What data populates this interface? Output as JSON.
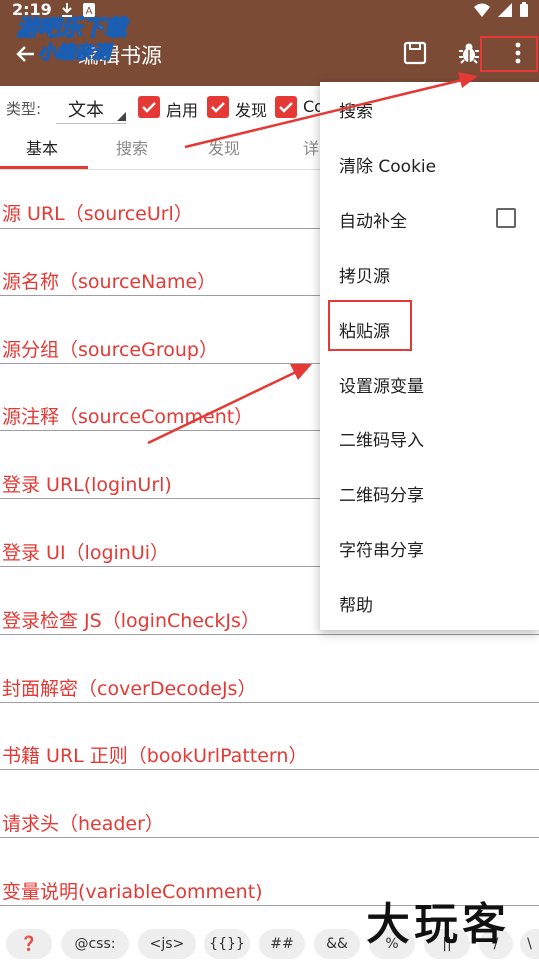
{
  "status_bar": {
    "time": "2:19"
  },
  "watermark": {
    "line1": "游吧乐下载",
    "line2": "小编亲测"
  },
  "app_bar": {
    "title": "编辑书源",
    "back_icon": "arrow-left-icon",
    "actions": [
      "save-icon",
      "bug-icon",
      "more-vert-icon"
    ]
  },
  "type_row": {
    "label": "类型:",
    "selected": "文本",
    "checkboxes": [
      {
        "label": "启用",
        "checked": true
      },
      {
        "label": "发现",
        "checked": true
      },
      {
        "label": "Co",
        "checked": true
      }
    ]
  },
  "tabs": [
    "基本",
    "搜索",
    "发现",
    "详"
  ],
  "fields": [
    "源 URL（sourceUrl）",
    "源名称（sourceName）",
    "源分组（sourceGroup）",
    "源注释（sourceComment）",
    "登录 URL(loginUrl)",
    "登录 UI（loginUi）",
    "登录检查 JS（loginCheckJs）",
    "封面解密（coverDecodeJs）",
    "书籍 URL 正则（bookUrlPattern）",
    "请求头（header）",
    "变量说明(variableComment)"
  ],
  "menu": {
    "items": [
      "搜索",
      "清除 Cookie",
      "自动补全",
      "拷贝源",
      "粘贴源",
      "设置源变量",
      "二维码导入",
      "二维码分享",
      "字符串分享",
      "帮助"
    ],
    "auto_complete_checked": false
  },
  "bottom_bar": {
    "chips": [
      "❓",
      "@css:",
      "<js>",
      "{{}}",
      "##",
      "&&",
      "%",
      "||",
      "/",
      "\\"
    ]
  },
  "brand_watermark": "大玩客",
  "colors": {
    "app_bar": "#7b4b36",
    "accent": "#e53935",
    "menu_bg": "#ffffff"
  }
}
